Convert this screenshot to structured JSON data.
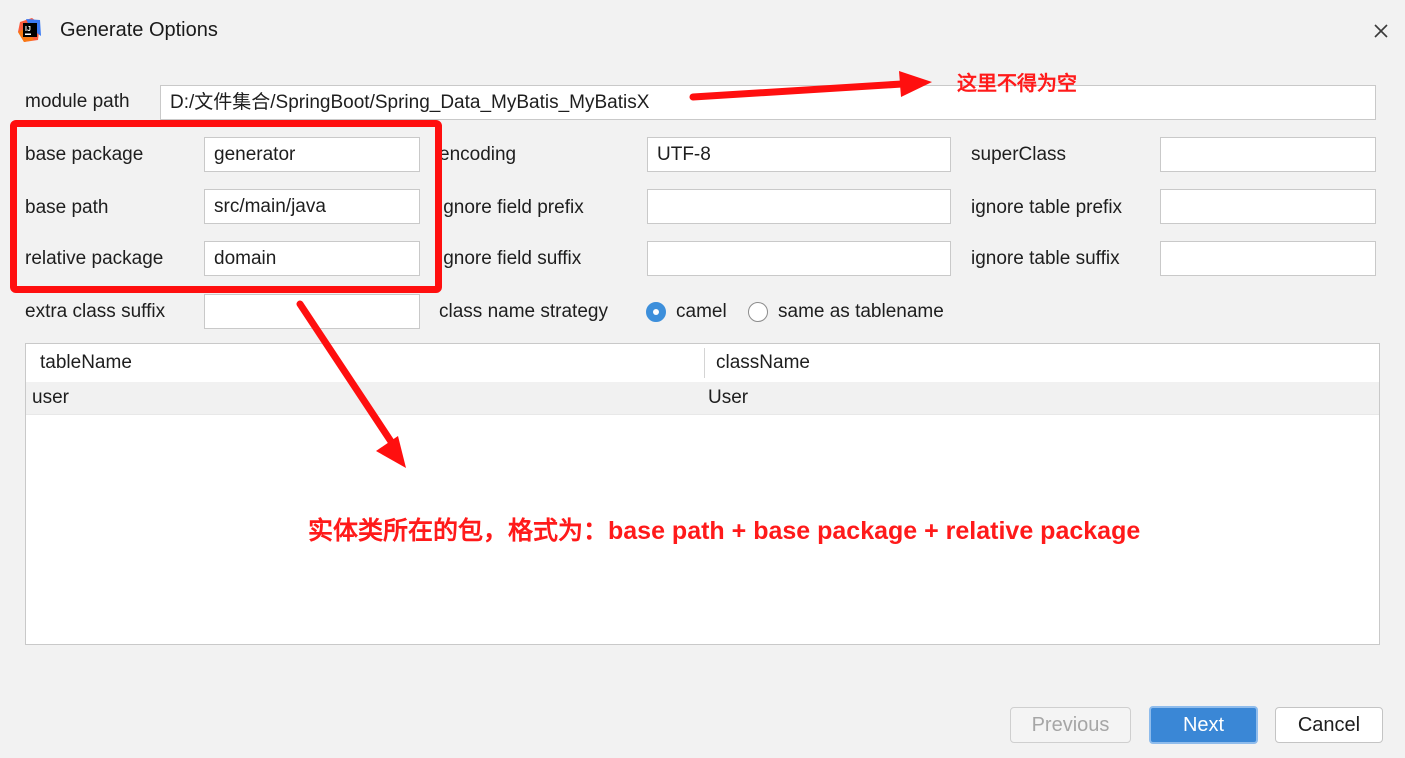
{
  "window": {
    "title": "Generate Options",
    "app_icon": "intellij-idea-icon",
    "close_icon": "close-icon"
  },
  "form": {
    "module_path": {
      "label": "module path",
      "value": "D:/文件集合/SpringBoot/Spring_Data_MyBatis_MyBatisX"
    },
    "base_package": {
      "label": "base package",
      "value": "generator"
    },
    "base_path": {
      "label": "base path",
      "value": "src/main/java"
    },
    "relative_package": {
      "label": "relative package",
      "value": "domain"
    },
    "extra_class_suffix": {
      "label": "extra class suffix",
      "value": ""
    },
    "encoding": {
      "label": "encoding",
      "value": "UTF-8"
    },
    "ignore_field_prefix": {
      "label": "ignore field prefix",
      "value": ""
    },
    "ignore_field_suffix": {
      "label": "ignore field suffix",
      "value": ""
    },
    "super_class": {
      "label": "superClass",
      "value": ""
    },
    "ignore_table_prefix": {
      "label": "ignore table prefix",
      "value": ""
    },
    "ignore_table_suffix": {
      "label": "ignore table suffix",
      "value": ""
    },
    "class_name_strategy": {
      "label": "class name strategy",
      "options": [
        "camel",
        "same as tablename"
      ],
      "selected": "camel"
    }
  },
  "table": {
    "columns": [
      "tableName",
      "className"
    ],
    "rows": [
      {
        "tableName": "user",
        "className": "User"
      }
    ]
  },
  "buttons": {
    "previous": "Previous",
    "next": "Next",
    "cancel": "Cancel"
  },
  "annotations": {
    "module_path_note": "这里不得为空",
    "package_note": "实体类所在的包，格式为：base path + base package + relative package",
    "color": "#ff1a1a"
  },
  "colors": {
    "accent": "#3a87d6",
    "annotation": "#ff0f0f",
    "background": "#f2f2f2"
  }
}
